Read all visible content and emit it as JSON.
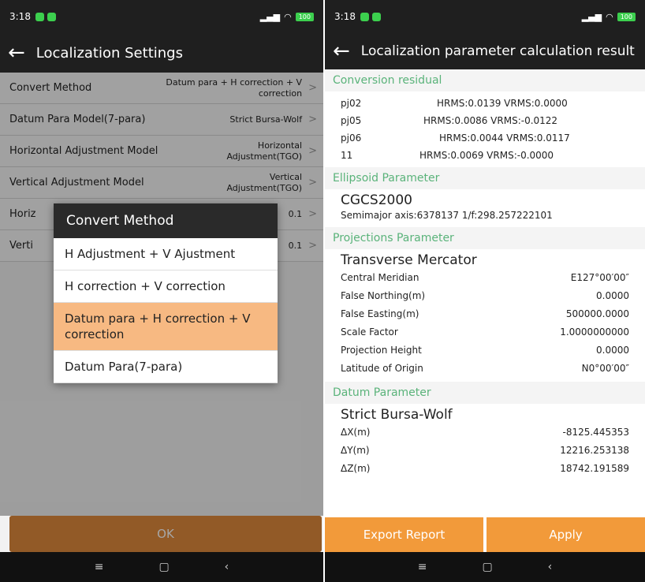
{
  "left": {
    "status": {
      "time": "3:18",
      "battery": "100"
    },
    "title": "Localization Settings",
    "rows": [
      {
        "label": "Convert Method",
        "value": "Datum para + H correction + V correction"
      },
      {
        "label": "Datum Para Model(7-para)",
        "value": "Strict Bursa-Wolf"
      },
      {
        "label": "Horizontal Adjustment Model",
        "value": "Horizontal Adjustment(TGO)"
      },
      {
        "label": "Vertical Adjustment Model",
        "value": "Vertical Adjustment(TGO)"
      },
      {
        "label": "Horiz",
        "value": "0.1"
      },
      {
        "label": "Verti",
        "value": "0.1"
      }
    ],
    "dialog": {
      "title": "Convert Method",
      "options": [
        "H Adjustment + V Ajustment",
        "H correction + V correction",
        "Datum para + H correction + V correction",
        "Datum Para(7-para)"
      ],
      "selected_index": 2
    },
    "ok_label": "OK"
  },
  "right": {
    "status": {
      "time": "3:18",
      "battery": "100"
    },
    "title": "Localization parameter calculation result",
    "residual_title": "Conversion residual",
    "residuals": [
      {
        "point": "pj02",
        "value": "HRMS:0.0139 VRMS:0.0000"
      },
      {
        "point": "pj05",
        "value": "HRMS:0.0086 VRMS:-0.0122"
      },
      {
        "point": "pj06",
        "value": "HRMS:0.0044 VRMS:0.0117"
      },
      {
        "point": "11",
        "value": "HRMS:0.0069 VRMS:-0.0000"
      }
    ],
    "ellipsoid_title": "Ellipsoid Parameter",
    "ellipsoid_name": "CGCS2000",
    "ellipsoid_detail": "Semimajor axis:6378137  1/f:298.257222101",
    "projection_title": "Projections Parameter",
    "projection_name": "Transverse Mercator",
    "projection_params": [
      {
        "k": "Central Meridian",
        "v": "E127°00′00″"
      },
      {
        "k": "False Northing(m)",
        "v": "0.0000"
      },
      {
        "k": "False Easting(m)",
        "v": "500000.0000"
      },
      {
        "k": "Scale Factor",
        "v": "1.0000000000"
      },
      {
        "k": "Projection Height",
        "v": "0.0000"
      },
      {
        "k": "Latitude of Origin",
        "v": "N0°00′00″"
      }
    ],
    "datum_title": "Datum Parameter",
    "datum_name": "Strict Bursa-Wolf",
    "datum_params": [
      {
        "k": "ΔX(m)",
        "v": "-8125.445353"
      },
      {
        "k": "ΔY(m)",
        "v": "12216.253138"
      },
      {
        "k": "ΔZ(m)",
        "v": "18742.191589"
      }
    ],
    "export_label": "Export Report",
    "apply_label": "Apply"
  },
  "nav": {
    "recents": "≡",
    "home": "▢",
    "back": "‹"
  }
}
